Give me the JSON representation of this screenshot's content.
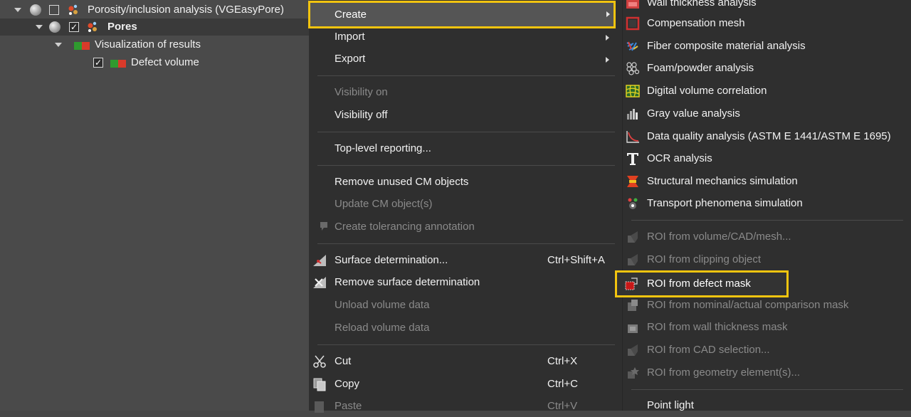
{
  "tree": {
    "items": [
      {
        "label": "Porosity/inclusion analysis (VGEasyPore)"
      },
      {
        "label": "Pores"
      },
      {
        "label": "Visualization of results"
      },
      {
        "label": "Defect volume"
      }
    ]
  },
  "menu": {
    "create": "Create",
    "import": "Import",
    "export": "Export",
    "visibility_on": "Visibility on",
    "visibility_off": "Visibility off",
    "top_level_reporting": "Top-level reporting...",
    "remove_unused_cm": "Remove unused CM objects",
    "update_cm": "Update CM object(s)",
    "create_tolerancing": "Create tolerancing annotation",
    "surface_determination": "Surface determination...",
    "surface_determination_shortcut": "Ctrl+Shift+A",
    "remove_surface_determination": "Remove surface determination",
    "unload_volume": "Unload volume data",
    "reload_volume": "Reload volume data",
    "cut": "Cut",
    "cut_shortcut": "Ctrl+X",
    "copy": "Copy",
    "copy_shortcut": "Ctrl+C",
    "paste": "Paste",
    "paste_shortcut": "Ctrl+V"
  },
  "submenu": {
    "wall_thickness": "Wall thickness analysis",
    "compensation_mesh": "Compensation mesh",
    "fiber_composite": "Fiber composite material analysis",
    "foam_powder": "Foam/powder analysis",
    "dvc": "Digital volume correlation",
    "gray_value": "Gray value analysis",
    "data_quality": "Data quality analysis (ASTM E 1441/ASTM E 1695)",
    "ocr": "OCR analysis",
    "structural_mechanics": "Structural mechanics simulation",
    "transport_phenomena": "Transport phenomena simulation",
    "roi_volume_cad_mesh": "ROI from volume/CAD/mesh...",
    "roi_clipping": "ROI from clipping object",
    "roi_defect_mask": "ROI from defect mask",
    "roi_nominal_actual": "ROI from nominal/actual comparison mask",
    "roi_wall_thickness": "ROI from wall thickness mask",
    "roi_cad_selection": "ROI from CAD selection...",
    "roi_geometry_element": "ROI from geometry element(s)...",
    "point_light": "Point light"
  },
  "colors": {
    "highlight": "#f2c40f",
    "menu_bg": "#2f2f2f",
    "panel_bg": "#4a4a4a"
  }
}
